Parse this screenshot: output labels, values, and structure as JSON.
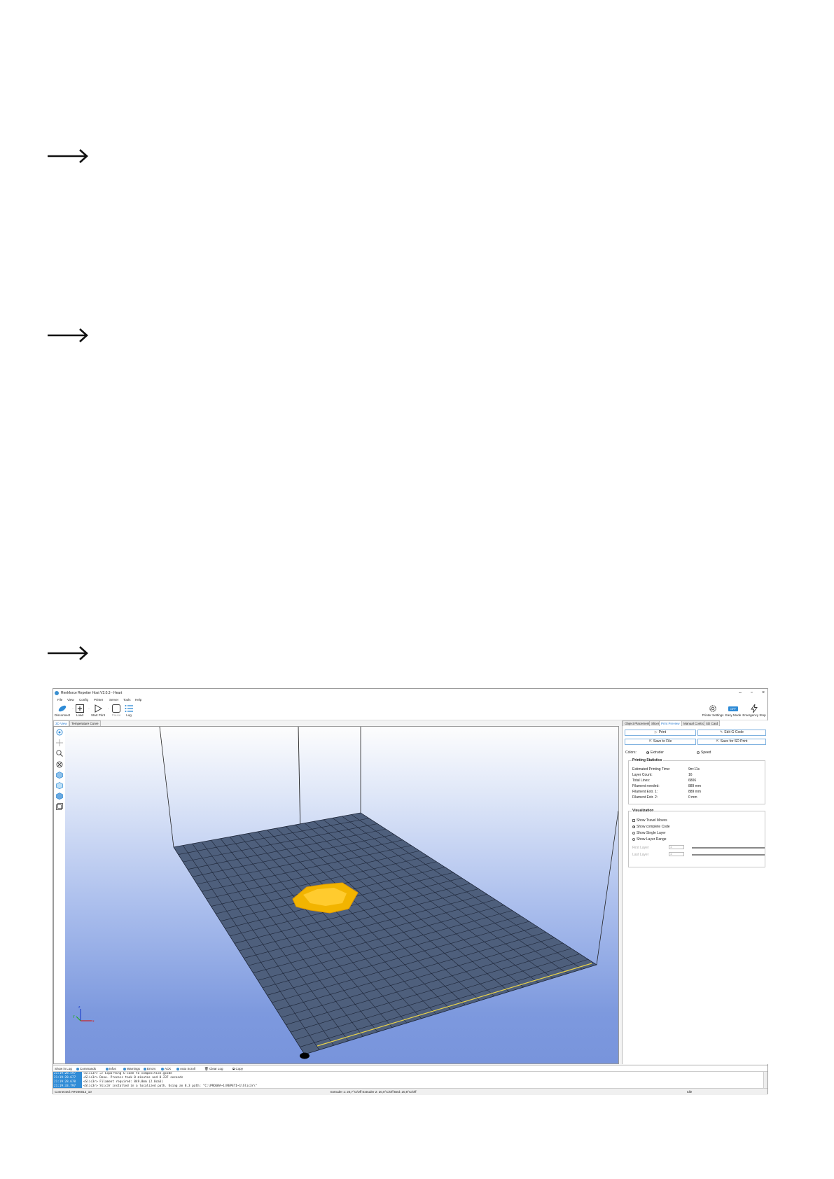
{
  "window": {
    "title": "Renkforce Repetier Host V2.0.3 - Heart",
    "controls": {
      "minimize": "–",
      "maximize": "▫",
      "close": "×"
    }
  },
  "menu": [
    "File",
    "View",
    "Config",
    "Printer",
    "Server",
    "Tools",
    "Help"
  ],
  "toolbar": {
    "disconnect": "Disconnect",
    "load": "Load",
    "start_print": "Start Print",
    "pause": "Pause",
    "log": "Log",
    "printer_settings": "Printer Settings",
    "easy_mode": "Easy Mode",
    "easy_mode_badge": "OFF",
    "emergency_stop": "Emergency Stop"
  },
  "view_tabs": [
    "3D View",
    "Temperature Curve"
  ],
  "right_tabs": [
    "Object Placement",
    "Slicer",
    "Print Preview",
    "Manual Control",
    "SD Card"
  ],
  "preview": {
    "print_button": "Print",
    "edit_gcode_button": "Edit G-Code",
    "save_to_file_button": "Save to File",
    "save_for_sd_button": "Save for SD Print",
    "colors_label": "Colors:",
    "color_options": [
      "Extruder",
      "Speed"
    ],
    "color_selected": "Extruder"
  },
  "statistics": {
    "title": "Printing Statistics",
    "rows": [
      {
        "label": "Estimated Printing Time:",
        "value": "9m:11s"
      },
      {
        "label": "Layer Count:",
        "value": "16"
      },
      {
        "label": "Total Lines:",
        "value": "6806"
      },
      {
        "label": "Filament needed:",
        "value": "889 mm"
      },
      {
        "label": "Filament Extr. 1:",
        "value": "889 mm"
      },
      {
        "label": "Filament Extr. 2:",
        "value": "0 mm"
      }
    ]
  },
  "visualization": {
    "title": "Visualization",
    "show_travel_moves": "Show Travel Moves",
    "show_complete_code": "Show complete Code",
    "show_single_layer": "Show Single Layer",
    "show_layer_range": "Show Layer Range",
    "selected": "Show complete Code",
    "first_layer_label": "First Layer",
    "first_layer_value": "1",
    "last_layer_label": "Last Layer",
    "last_layer_value": "1"
  },
  "log_toolbar": [
    "Show in Log",
    "Commands",
    "Infos",
    "Warnings",
    "Errors",
    "ACK",
    "Auto Scroll",
    "Clear Log",
    "Copy"
  ],
  "log_lines": [
    {
      "time": "21:19:28.597",
      "msg": "<Slic3r> => Exporting G-code to composition.gcode"
    },
    {
      "time": "21:19:28.677",
      "msg": "<Slic3r> Done. Process took 0 minutes and 0.237 seconds"
    },
    {
      "time": "21:19:28.678",
      "msg": "<Slic3r> Filament required: 849.8mm (2.0cm3)"
    },
    {
      "time": "21:19:33.797",
      "msg": "<Slic3r> Slic3r installed in a localized path. Using an 8.3 path: \"C:\\PROGRA~1\\REPETI~1\\Slic3r\\\""
    }
  ],
  "status": {
    "connection": "Connected: RF200012_10",
    "temps": "Extruder 1: 20,7°C/Off Extruder 2: 20,0°C/Off Bed: 20,8°C/Off",
    "state": "Idle"
  },
  "colors": {
    "accent": "#2f8bd6",
    "bed": "#4e5f7c",
    "grid_line": "#1c2436",
    "model": "#f2b400",
    "extruder_path": "#e8d24a"
  }
}
